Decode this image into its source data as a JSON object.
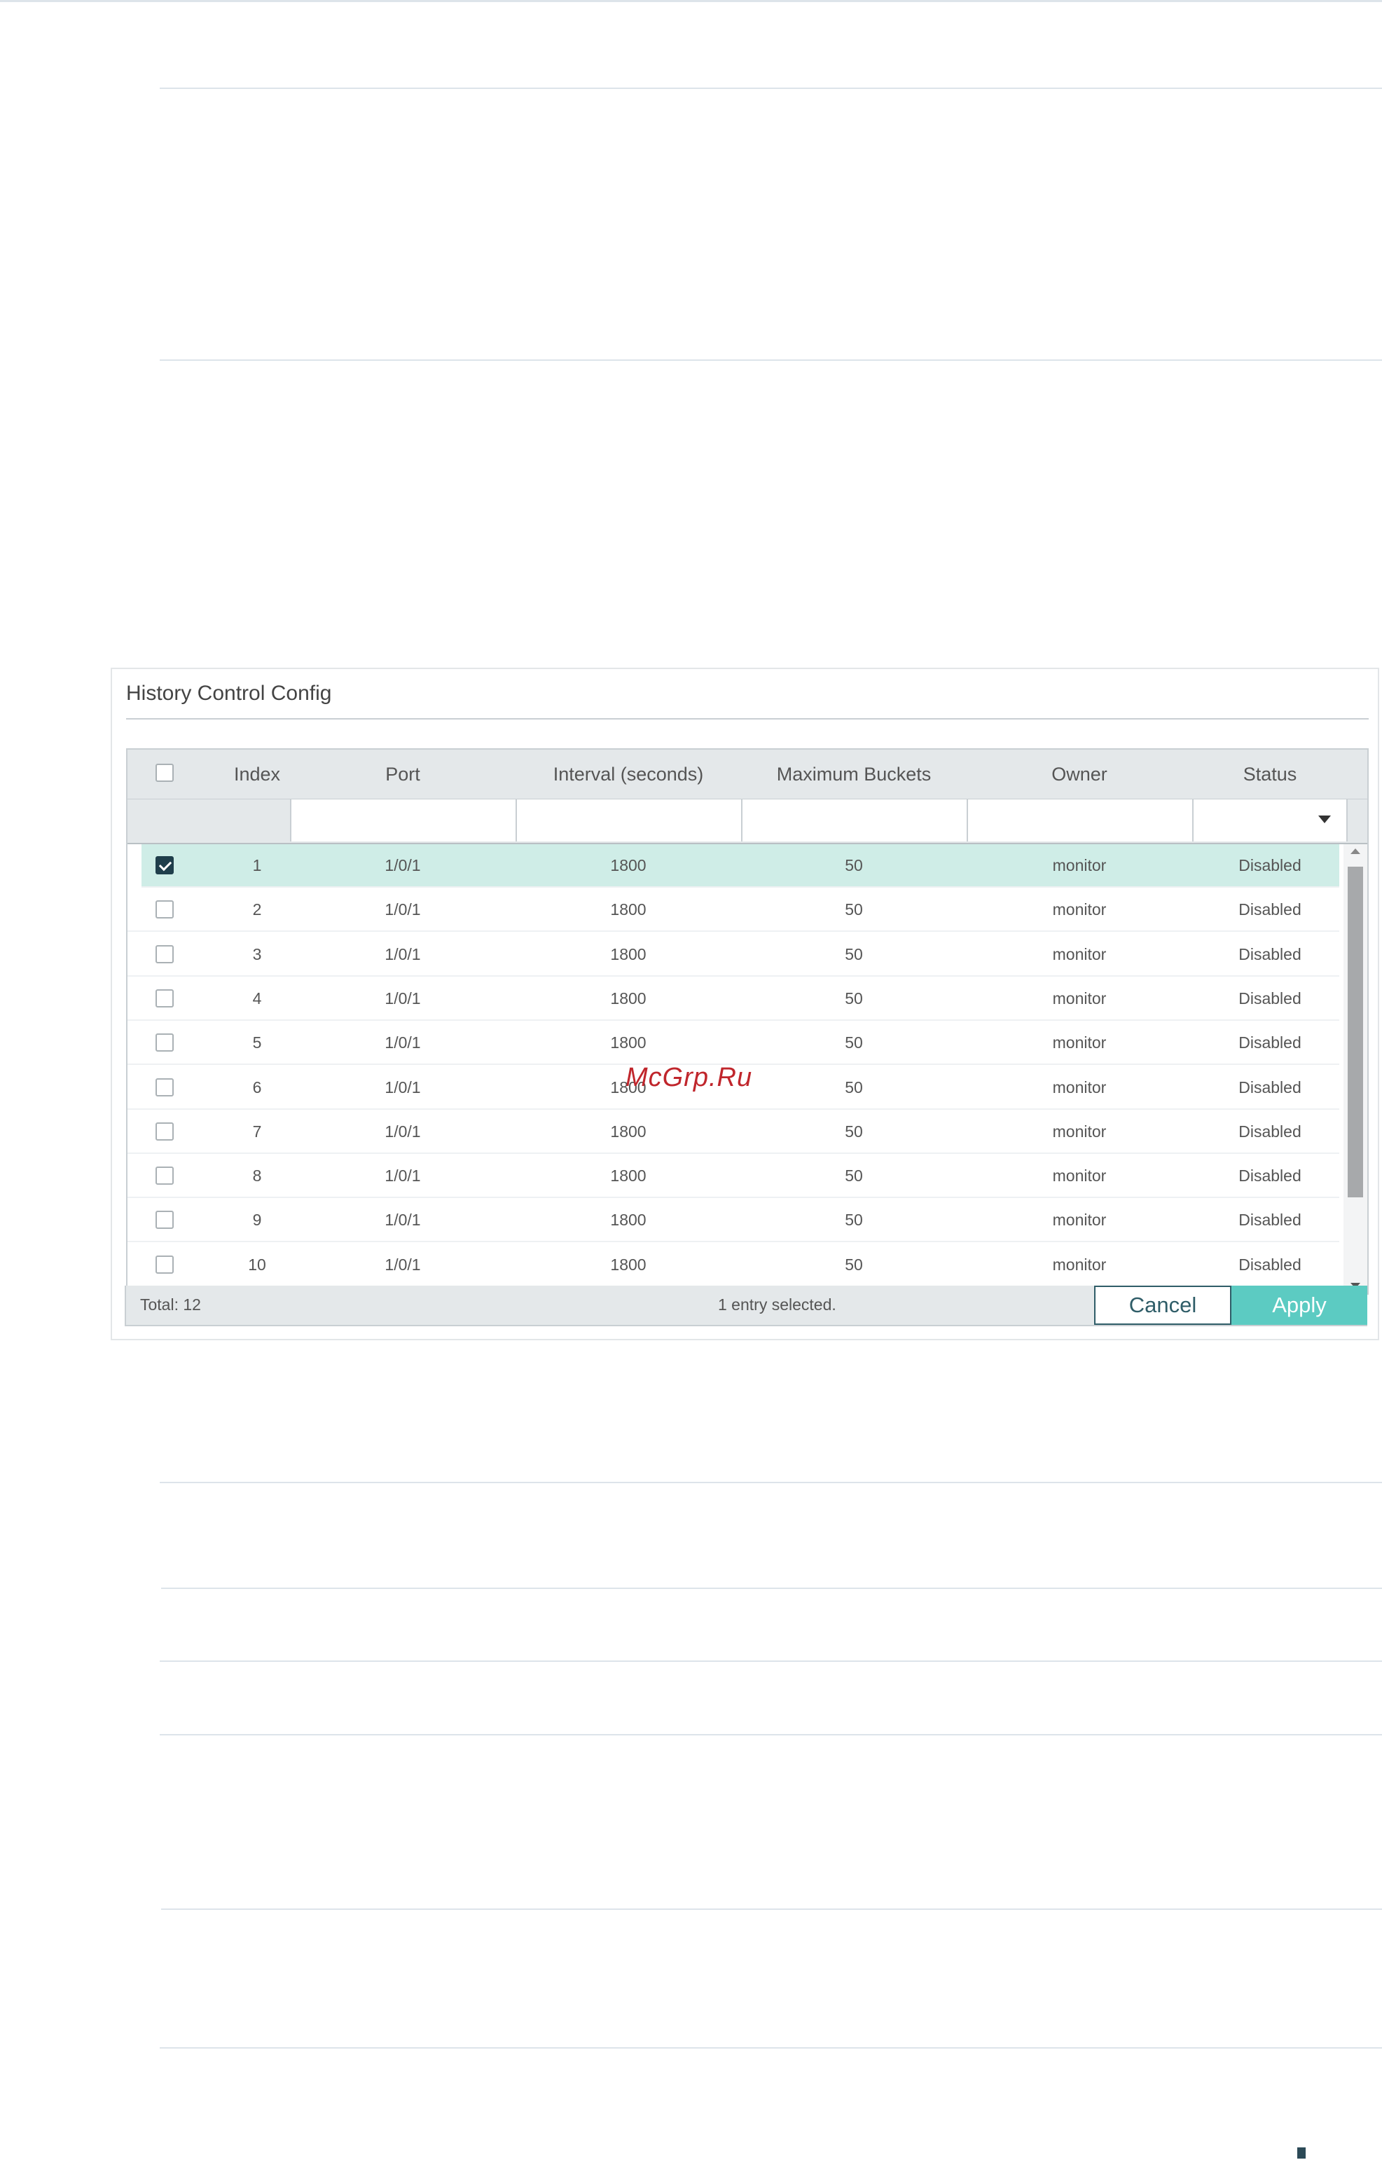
{
  "panel": {
    "title": "History Control Config"
  },
  "table": {
    "columns": [
      "Index",
      "Port",
      "Interval (seconds)",
      "Maximum Buckets",
      "Owner",
      "Status"
    ],
    "rows": [
      {
        "checked": true,
        "index": "1",
        "port": "1/0/1",
        "interval": "1800",
        "buckets": "50",
        "owner": "monitor",
        "status": "Disabled"
      },
      {
        "checked": false,
        "index": "2",
        "port": "1/0/1",
        "interval": "1800",
        "buckets": "50",
        "owner": "monitor",
        "status": "Disabled"
      },
      {
        "checked": false,
        "index": "3",
        "port": "1/0/1",
        "interval": "1800",
        "buckets": "50",
        "owner": "monitor",
        "status": "Disabled"
      },
      {
        "checked": false,
        "index": "4",
        "port": "1/0/1",
        "interval": "1800",
        "buckets": "50",
        "owner": "monitor",
        "status": "Disabled"
      },
      {
        "checked": false,
        "index": "5",
        "port": "1/0/1",
        "interval": "1800",
        "buckets": "50",
        "owner": "monitor",
        "status": "Disabled"
      },
      {
        "checked": false,
        "index": "6",
        "port": "1/0/1",
        "interval": "1800",
        "buckets": "50",
        "owner": "monitor",
        "status": "Disabled"
      },
      {
        "checked": false,
        "index": "7",
        "port": "1/0/1",
        "interval": "1800",
        "buckets": "50",
        "owner": "monitor",
        "status": "Disabled"
      },
      {
        "checked": false,
        "index": "8",
        "port": "1/0/1",
        "interval": "1800",
        "buckets": "50",
        "owner": "monitor",
        "status": "Disabled"
      },
      {
        "checked": false,
        "index": "9",
        "port": "1/0/1",
        "interval": "1800",
        "buckets": "50",
        "owner": "monitor",
        "status": "Disabled"
      },
      {
        "checked": false,
        "index": "10",
        "port": "1/0/1",
        "interval": "1800",
        "buckets": "50",
        "owner": "monitor",
        "status": "Disabled"
      }
    ]
  },
  "footer": {
    "total": "Total: 12",
    "selected": "1 entry selected.",
    "cancel_label": "Cancel",
    "apply_label": "Apply"
  },
  "watermark": "McGrp.Ru",
  "colors": {
    "accent": "#5ccbc2",
    "selected_row": "#cfede7",
    "checkbox_checked": "#1f3e4b",
    "watermark": "#c0262c"
  }
}
